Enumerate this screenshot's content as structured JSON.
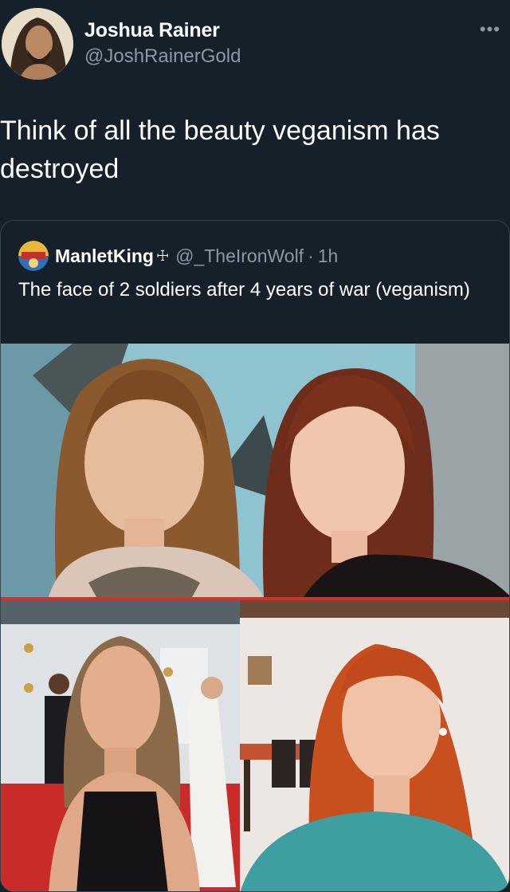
{
  "author": {
    "display_name": "Joshua Rainer",
    "handle": "@JoshRainerGold",
    "avatar_icon": "person-avatar-icon"
  },
  "menu": {
    "more_label": "•••"
  },
  "tweet": {
    "text": "Think of all the beauty veganism has destroyed"
  },
  "quoted": {
    "display_name": "ManletKing",
    "name_symbol": "☩",
    "handle": "@_TheIronWolf",
    "separator": "·",
    "time": "1h",
    "text": "The face of 2 soldiers after 4 years of war (veganism)",
    "avatar_icon": "badge-avatar-icon"
  },
  "colors": {
    "background": "#15202b",
    "secondary_text": "#8b98a5",
    "border": "#38444d",
    "divider_red": "#d2312f"
  }
}
